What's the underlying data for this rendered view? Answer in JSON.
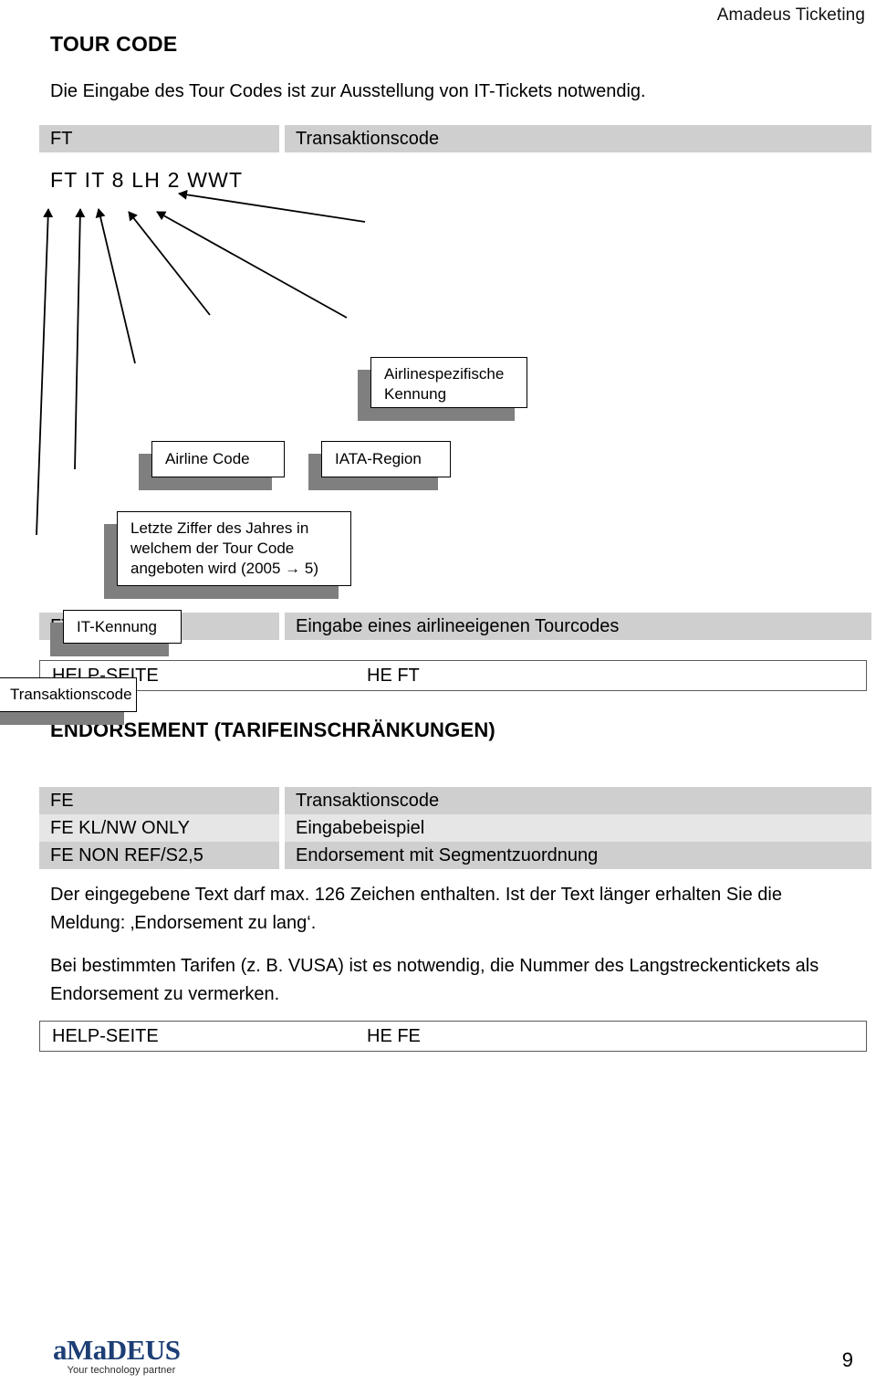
{
  "header": {
    "brand": "Amadeus Ticketing"
  },
  "sections": {
    "tour_code": {
      "title": "TOUR CODE",
      "intro": "Die Eingabe des Tour Codes ist zur Ausstellung von IT-Tickets notwendig.",
      "table": [
        {
          "left": "FT",
          "right": "Transaktionscode"
        }
      ],
      "table2": [
        {
          "left": "FT*Freier Text",
          "right": "Eingabe eines airlineeigenen Tourcodes"
        }
      ],
      "help": {
        "label": "HELP-SEITE",
        "value": "HE FT"
      }
    },
    "endorsement": {
      "title": "ENDORSEMENT (TARIFEINSCHRÄNKUNGEN)",
      "table": [
        {
          "left": "FE",
          "right": "Transaktionscode"
        },
        {
          "left": "FE KL/NW ONLY",
          "right": "Eingabebeispiel"
        },
        {
          "left": "FE NON REF/S2,5",
          "right": "Endorsement mit Segmentzuordnung"
        }
      ],
      "para_max_chars": "Der eingegebene Text darf max. 126 Zeichen enthalten. Ist der Text länger erhalten Sie die Meldung: ‚Endorsement zu lang‘.",
      "para_vusa": "Bei bestimmten Tarifen (z. B. VUSA) ist es notwendig, die Nummer des Langstreckentickets als Endorsement zu vermerken.",
      "help": {
        "label": "HELP-SEITE",
        "value": "HE FE"
      }
    }
  },
  "diagram": {
    "code_sample": "FT IT 8 LH 2 WWT",
    "callouts": {
      "airlinespezifische": "Airlinespezifische Kennung",
      "airline_code": "Airline Code",
      "iata_region": "IATA-Region",
      "letzte_ziffer": "Letzte Ziffer des Jahres in welchem der Tour Code angeboten wird (2005 → 5)",
      "it_kennung": "IT-Kennung",
      "transaktionscode": "Transaktionscode"
    }
  },
  "footer": {
    "logo_word": "aMaDEUS",
    "logo_tagline": "Your technology partner",
    "page_number": "9"
  },
  "colors": {
    "shade_dark": "#cfcfcf",
    "shade_light": "#e6e6e6",
    "shadow": "#7f7f7f",
    "logo_blue": "#1d3f75"
  }
}
